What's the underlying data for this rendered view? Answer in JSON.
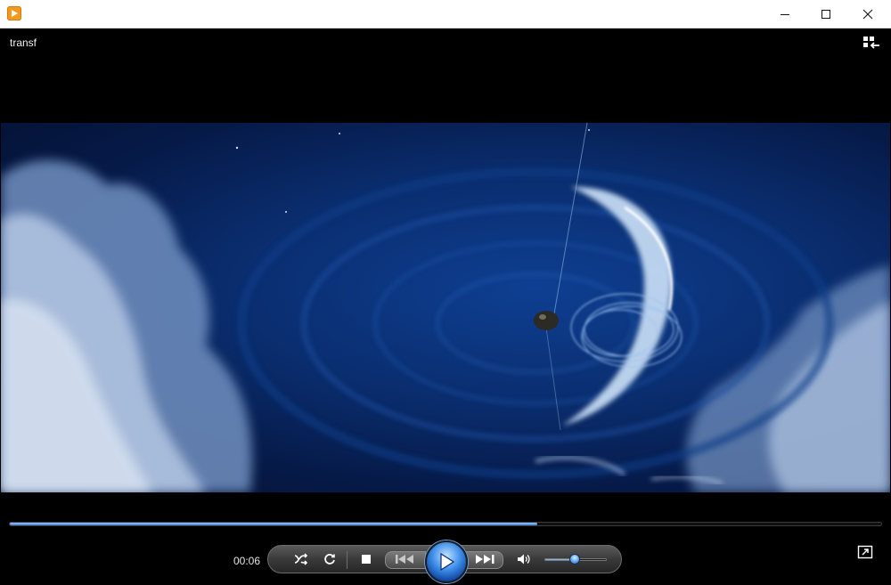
{
  "window": {
    "app_icon": "media-player-icon",
    "controls": {
      "minimize_icon": "minimize-icon",
      "maximize_icon": "maximize-icon",
      "close_icon": "close-icon"
    }
  },
  "media": {
    "title": "transf",
    "playlist_toggle_icon": "switch-to-library-icon"
  },
  "playback": {
    "elapsed": "00:06",
    "progress": 0.605,
    "volume": 0.48,
    "play_state": "paused",
    "buttons": {
      "shuffle_icon": "shuffle-icon",
      "repeat_icon": "repeat-icon",
      "stop_icon": "stop-icon",
      "previous_icon": "previous-icon",
      "play_icon": "play-icon",
      "next_icon": "next-icon",
      "mute_icon": "speaker-icon"
    },
    "fullscreen_icon": "fullscreen-icon"
  },
  "colors": {
    "accent_blue": "#3d7fd6",
    "titlebar": "#ffffff",
    "background": "#000000",
    "app_icon_orange": "#f39a1e"
  }
}
